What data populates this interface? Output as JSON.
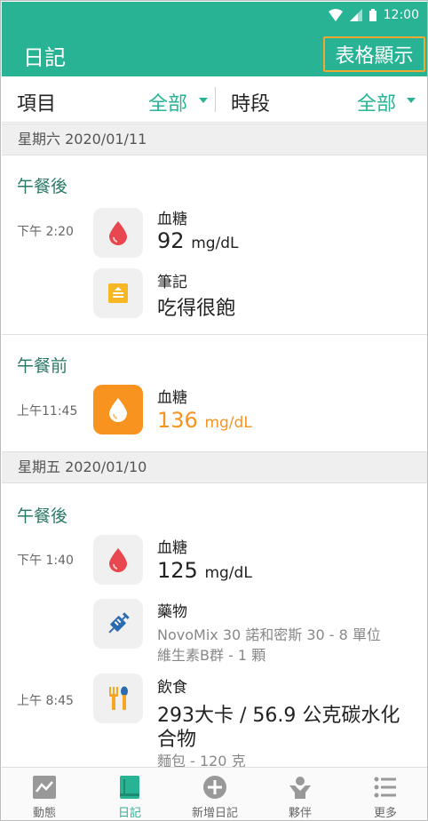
{
  "status_bar": {
    "time": "12:00"
  },
  "app_bar": {
    "title": "日記",
    "table_button": "表格顯示"
  },
  "filter": {
    "item_label": "項目",
    "item_value": "全部",
    "period_label": "時段",
    "period_value": "全部"
  },
  "days": [
    {
      "date": "星期六 2020/01/11",
      "sections": [
        {
          "title": "午餐後",
          "entries": [
            {
              "time": "下午 2:20",
              "icon": "blood-drop-icon",
              "title": "血糖",
              "value": "92",
              "unit": "mg/dL"
            },
            {
              "icon": "note-icon",
              "title": "筆記",
              "text": "吃得很飽"
            }
          ]
        },
        {
          "title": "午餐前",
          "entries": [
            {
              "time": "上午11:45",
              "icon": "blood-drop-icon",
              "title": "血糖",
              "value": "136",
              "unit": "mg/dL",
              "highlight": "#f7931e"
            }
          ]
        }
      ]
    },
    {
      "date": "星期五 2020/01/10",
      "sections": [
        {
          "title": "午餐後",
          "entries": [
            {
              "time": "下午 1:40",
              "icon": "blood-drop-icon",
              "title": "血糖",
              "value": "125",
              "unit": "mg/dL"
            },
            {
              "icon": "syringe-icon",
              "title": "藥物",
              "lines": [
                "NovoMix 30 諾和密斯 30 - 8 單位",
                "維生素B群 - 1 顆"
              ]
            },
            {
              "time": "上午 8:45",
              "icon": "fork-spoon-icon",
              "title": "飲食",
              "value_line1": "293大卡 / 56.9 公克碳水化",
              "value_line2": "合物",
              "detail": "麵包 - 120 克"
            }
          ]
        }
      ]
    }
  ],
  "bottom_nav": [
    {
      "label": "動態",
      "icon": "activity-chart-icon"
    },
    {
      "label": "日記",
      "icon": "diary-book-icon",
      "active": true
    },
    {
      "label": "新增日記",
      "icon": "add-circle-icon"
    },
    {
      "label": "夥伴",
      "icon": "partner-icon"
    },
    {
      "label": "更多",
      "icon": "list-more-icon"
    }
  ],
  "colors": {
    "primary": "#27b394",
    "accent": "#f7931e",
    "blood_red": "#e8474f"
  }
}
